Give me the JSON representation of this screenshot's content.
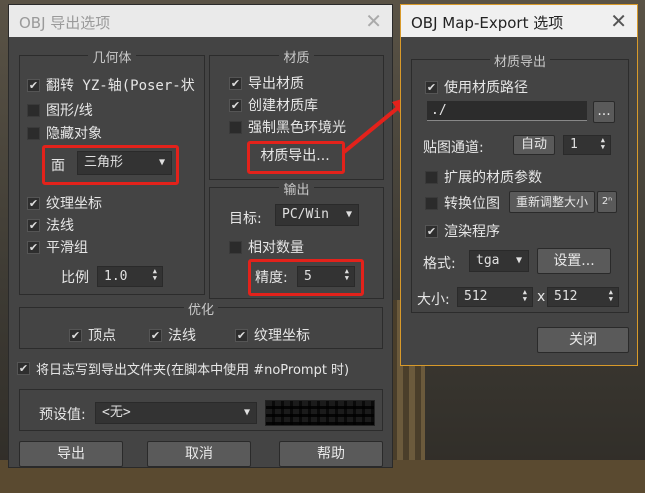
{
  "export_dialog": {
    "title": "OBJ 导出选项",
    "geometry": {
      "title": "几何体",
      "flip": "翻转 YZ-轴(Poser-状",
      "shapes": "图形/线",
      "hidden": "隐藏对象",
      "face_label": "面",
      "face_value": "三角形",
      "texcoords": "纹理坐标",
      "normals": "法线",
      "smooth": "平滑组",
      "scale_label": "比例",
      "scale_value": "1.0"
    },
    "material": {
      "title": "材质",
      "export_mat": "导出材质",
      "create_lib": "创建材质库",
      "force_black": "强制黑色环境光",
      "map_export_button": "材质导出..."
    },
    "output": {
      "title": "输出",
      "target_label": "目标:",
      "target_value": "PC/Win",
      "relative": "相对数量",
      "precision_label": "精度:",
      "precision_value": "5"
    },
    "optimize": {
      "title": "优化",
      "vertices": "顶点",
      "normals": "法线",
      "texcoords": "纹理坐标"
    },
    "log_text": "将日志写到导出文件夹(在脚本中使用 #noPrompt 时)",
    "preset_label": "预设值:",
    "preset_value": "<无>",
    "buttons": {
      "export": "导出",
      "cancel": "取消",
      "help": "帮助"
    }
  },
  "map_dialog": {
    "title": "OBJ Map-Export 选项",
    "group_title": "材质导出",
    "use_path": "使用材质路径",
    "path_value": "./",
    "browse": "...",
    "channel_label": "贴图通道:",
    "auto_button": "自动",
    "channel_value": "1",
    "extended": "扩展的材质参数",
    "convert": "转换位图",
    "resize_button": "重新调整大小",
    "pow2": "2ⁿ",
    "render": "渲染程序",
    "format_label": "格式:",
    "format_value": "tga",
    "setup_button": "设置...",
    "size_label": "大小:",
    "size_w": "512",
    "size_x": "x",
    "size_h": "512",
    "close_button": "关闭"
  },
  "colors": {
    "highlight": "#e3221b",
    "active_border": "#d89a2a"
  }
}
